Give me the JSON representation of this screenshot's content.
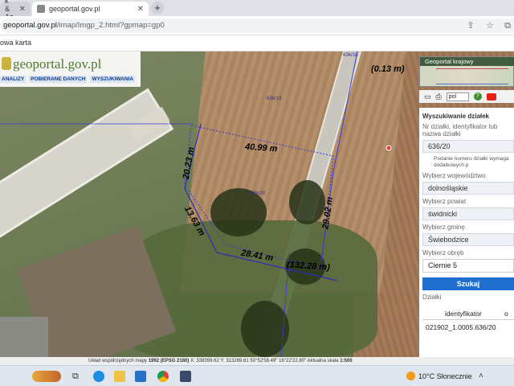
{
  "browser": {
    "tabs": [
      {
        "label": "k & Az",
        "active": false
      },
      {
        "label": "geoportal.gov.pl",
        "active": true
      }
    ],
    "new_tab": "+",
    "url_host": "geoportal.gov.pl",
    "url_path": "/imap/Imgp_2.html?gpmap=gp0",
    "bookmark": "owa karta"
  },
  "geoportal": {
    "logo": "geoportal.gov.pl",
    "menu": [
      "ANALIZY",
      "POBIERANE DANYCH",
      "WYSZUKIWANIA"
    ]
  },
  "map": {
    "dimensions": [
      {
        "id": "d-top",
        "text": "(0.13 m)"
      },
      {
        "id": "d-w",
        "text": "40.99 m"
      },
      {
        "id": "d-left",
        "text": "20.23 m"
      },
      {
        "id": "d-sw",
        "text": "13.63 m"
      },
      {
        "id": "d-right",
        "text": "29.02 m"
      },
      {
        "id": "d-bottom",
        "text": "28.41 m"
      },
      {
        "id": "d-extra",
        "text": "(132.28 m)"
      }
    ],
    "parcel_labels": {
      "p1": "636/18",
      "p2": "636/20",
      "p3": "636/19"
    }
  },
  "panel": {
    "mini_map_title": "Geoportal krajowy",
    "lang": "pol",
    "heading": "Wyszukiwanie działek",
    "id_label": "Nr działki, identyfikator lub nazwa działki",
    "id_value": "636/20",
    "hint": "Podanie numeru działki wymaga dodatkowych p",
    "wojewodztwo_label": "Wybierz województwo",
    "wojewodztwo": "dolnośląskie",
    "powiat_label": "Wybierz powiat",
    "powiat": "świdnicki",
    "gmina_label": "Wybierz gminę",
    "gmina": "Świebodzice",
    "obreb_label": "Wybierz obręb",
    "obreb": "Ciernie 5",
    "search_button": "Szukaj",
    "dzialki_label": "Działki",
    "col_identyfikator": "identyfikator",
    "col_second": "o",
    "result_row": "021902_1.0005.636/20"
  },
  "status_bar": {
    "prefix": "Układ współrzędnych mapy",
    "crs": "1992 (EPSG 2180)",
    "x": "X: 338399.62",
    "y": "Y: 313269.61",
    "lat": "50°52'58.49\"",
    "lon": "16°22'22.80\"",
    "scale_label": "Aktualna skala",
    "scale": "1:500"
  },
  "taskbar": {
    "weather": "10°C Słonecznie"
  }
}
